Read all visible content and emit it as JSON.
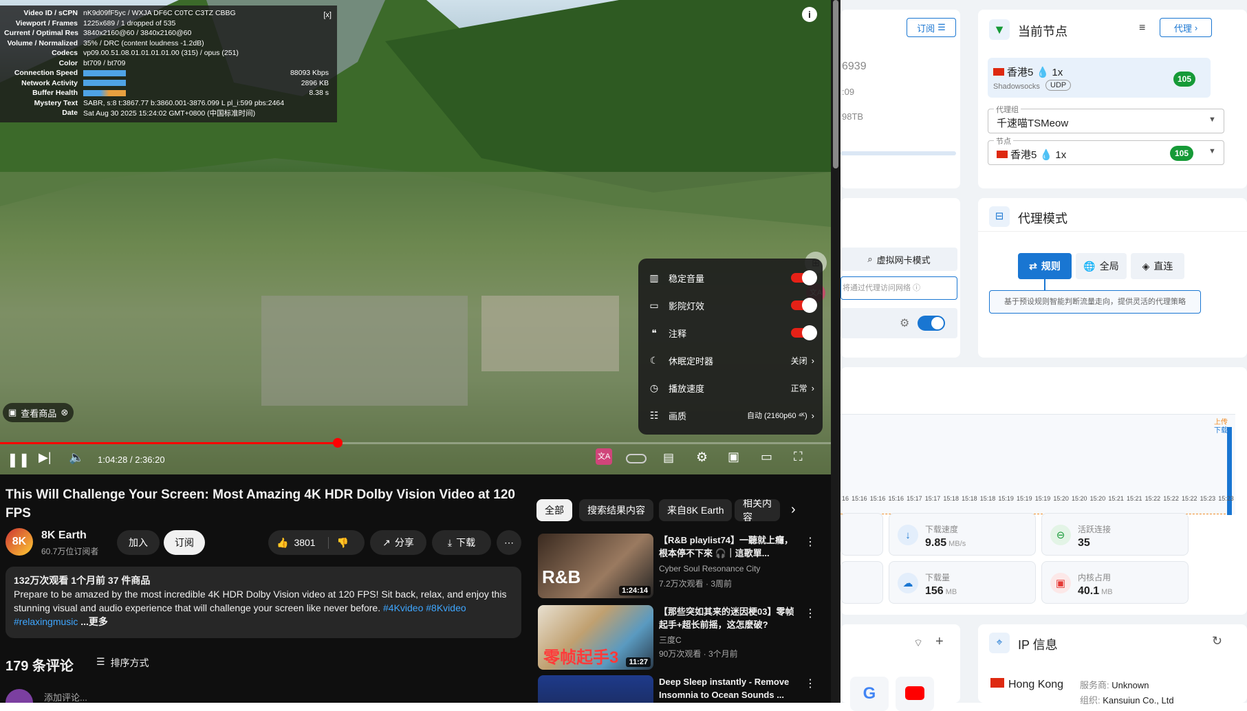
{
  "stats": {
    "rows": [
      {
        "k": "Video ID / sCPN",
        "v": "nK9d09fF5yc  /  WXJA DF6C C0TC C3TZ CBBG"
      },
      {
        "k": "Viewport / Frames",
        "v": "1225x689 / 1 dropped of 535"
      },
      {
        "k": "Current / Optimal Res",
        "v": "3840x2160@60 / 3840x2160@60"
      },
      {
        "k": "Volume / Normalized",
        "v": "35% / DRC (content loudness -1.2dB)"
      },
      {
        "k": "Codecs",
        "v": "vp09.00.51.08.01.01.01.01.00 (315) / opus (251)"
      },
      {
        "k": "Color",
        "v": "bt709 / bt709"
      },
      {
        "k": "Connection Speed",
        "v": "88093 Kbps"
      },
      {
        "k": "Network Activity",
        "v": "2896 KB"
      },
      {
        "k": "Buffer Health",
        "v": "8.38 s"
      },
      {
        "k": "Mystery Text",
        "v": "SABR, s:8 t:3867.77 b:3860.001-3876.099 L pl_i:599 pbs:2464"
      },
      {
        "k": "Date",
        "v": "Sat Aug 30 2025 15:24:02 GMT+0800 (中国标准时间)"
      }
    ],
    "close": "[x]"
  },
  "settings": {
    "items": [
      {
        "label": "稳定音量",
        "value": "",
        "toggle": true
      },
      {
        "label": "影院灯效",
        "value": "",
        "toggle": true
      },
      {
        "label": "注释",
        "value": "",
        "toggle": true
      },
      {
        "label": "休眠定时器",
        "value": "关闭",
        "toggle": false
      },
      {
        "label": "播放速度",
        "value": "正常",
        "toggle": false
      },
      {
        "label": "画质",
        "value": "自动 (2160p60 ⁴ᴷ)",
        "toggle": false
      }
    ]
  },
  "player": {
    "time": "1:04:28 / 2:36:20",
    "shopping": "查看商品",
    "progress": 0.412
  },
  "video": {
    "title": "This Will Challenge Your Screen: Most Amazing 4K HDR Dolby Vision Video at 120 FPS",
    "channel": "8K Earth",
    "subscribers": "60.7万位订阅者",
    "join": "加入",
    "subscribe": "订阅",
    "likes": "3801",
    "share": "分享",
    "download": "下载",
    "desc_stats": "132万次观看  1个月前  37 件商品",
    "desc": "Prepare to be amazed by the most incredible 4K HDR Dolby Vision video at 120 FPS! Sit back, relax, and enjoy this stunning visual and audio experience that will challenge your screen like never before.",
    "tags": "#4Kvideo #8Kvideo",
    "tag3": "#relaxingmusic",
    "more": "...更多",
    "comments": "179 条评论",
    "sort": "排序方式",
    "add_comment": "添加评论..."
  },
  "chips": [
    "全部",
    "搜索结果内容",
    "来自8K Earth",
    "相关内容"
  ],
  "recs": [
    {
      "title": "【R&B playlist74】一聽就上癮，根本停不下來 🎧｜這歌單...",
      "channel": "Cyber Soul Resonance City",
      "meta": "7.2万次观看 · 3周前",
      "dur": "1:24:14"
    },
    {
      "title": "【那些突如其来的迷因梗03】零帧起手+超长前摇，这怎麽破?",
      "channel": "三度C",
      "meta": "90万次观看 · 3个月前",
      "dur": "11:27"
    },
    {
      "title": "Deep Sleep instantly - Remove Insomnia to Ocean Sounds ...",
      "channel": "",
      "meta": "",
      "dur": ""
    }
  ],
  "clash": {
    "sub_btn": "订阅",
    "left_nums": [
      "6939",
      ":09",
      "98TB"
    ],
    "node_title": "当前节点",
    "proxy_btn": "代理",
    "node_name": "香港5",
    "node_rate": "1x",
    "node_type": "Shadowsocks",
    "node_udp": "UDP",
    "node_delay": "105",
    "group_label": "代理组",
    "group_value": "千速喵TSMeow",
    "node_label": "节点",
    "node_value": "香港5",
    "node_value_rate": "1x",
    "node_value_delay": "105",
    "vnic": "虚拟网卡模式",
    "vnic_hint": "将通过代理访问网络",
    "mode_title": "代理模式",
    "mode_rule": "规则",
    "mode_global": "全局",
    "mode_direct": "直连",
    "mode_desc": "基于预设规则智能判断流量走向，提供灵活的代理策略",
    "chart_up": "上传",
    "chart_down": "下载",
    "times": [
      "16",
      "15:16",
      "15:16",
      "15:16",
      "15:17",
      "15:17",
      "15:18",
      "15:18",
      "15:18",
      "15:19",
      "15:19",
      "15:19",
      "15:20",
      "15:20",
      "15:20",
      "15:21",
      "15:21",
      "15:22",
      "15:22",
      "15:22",
      "15:23",
      "15:23"
    ],
    "dl_speed_label": "下载速度",
    "dl_speed": "9.85",
    "dl_speed_unit": "MB/s",
    "conn_label": "活跃连接",
    "conn": "35",
    "dl_total_label": "下载量",
    "dl_total": "156",
    "dl_total_unit": "MB",
    "mem_label": "内核占用",
    "mem": "40.1",
    "mem_unit": "MB",
    "ip_title": "IP 信息",
    "ip_country": "Hong Kong",
    "isp_label": "服务商:",
    "isp": "Unknown",
    "org_label": "组织:",
    "org": "Kansuiun Co., Ltd"
  }
}
